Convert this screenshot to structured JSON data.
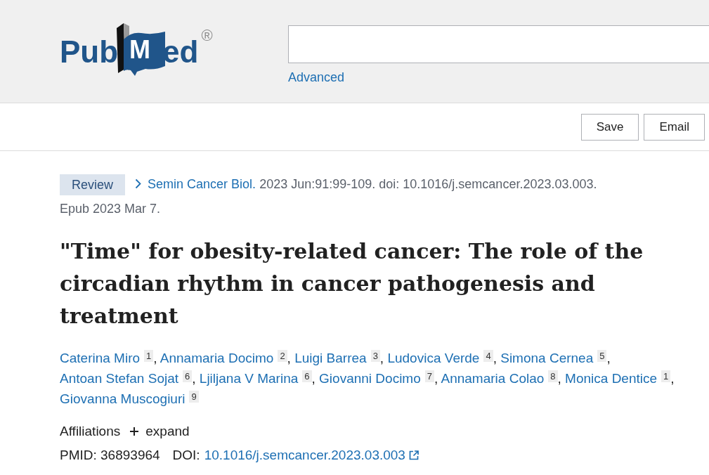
{
  "header": {
    "logo": {
      "before": "Pub",
      "book_letter": "M",
      "after": "ed",
      "mark": "®"
    },
    "advanced_link": "Advanced"
  },
  "toolbar": {
    "buttons": [
      "Save",
      "Email"
    ]
  },
  "citation": {
    "badge": "Review",
    "journal": "Semin Cancer Biol.",
    "details": "2023 Jun:91:99-109. doi: 10.1016/j.semcancer.2023.03.003.",
    "epub_date": "Epub 2023 Mar 7."
  },
  "title": "\"Time\" for obesity-related cancer: The role of the circadian rhythm in cancer pathogenesis and treatment",
  "authors": {
    "separator": ",",
    "list": [
      {
        "name": "Caterina Miro",
        "affiliation": "1"
      },
      {
        "name": "Annamaria Docimo",
        "affiliation": "2"
      },
      {
        "name": "Luigi Barrea",
        "affiliation": "3"
      },
      {
        "name": "Ludovica Verde",
        "affiliation": "4"
      },
      {
        "name": "Simona Cernea",
        "affiliation": "5"
      },
      {
        "name": "Antoan Stefan Sojat",
        "affiliation": "6"
      },
      {
        "name": "Ljiljana V Marina",
        "affiliation": "6"
      },
      {
        "name": "Giovanni Docimo",
        "affiliation": "7"
      },
      {
        "name": "Annamaria Colao",
        "affiliation": "8"
      },
      {
        "name": "Monica Dentice",
        "affiliation": "1"
      },
      {
        "name": "Giovanna Muscogiuri",
        "affiliation": "9"
      }
    ]
  },
  "affiliations": {
    "label": "Affiliations",
    "toggle": "expand"
  },
  "identifiers": {
    "pmid": "PMID: 36893964",
    "doi_label": "DOI:",
    "doi": "10.1016/j.semcancer.2023.03.003"
  }
}
